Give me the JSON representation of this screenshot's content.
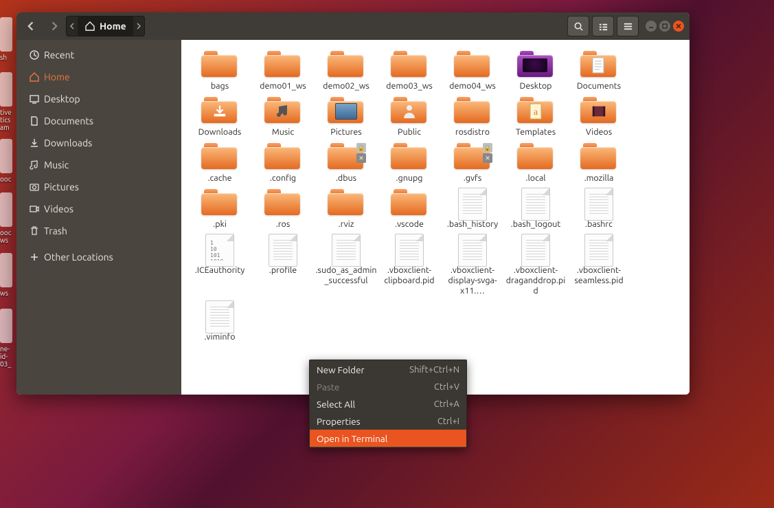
{
  "breadcrumb": {
    "current": "Home"
  },
  "sidebar": {
    "items": [
      {
        "label": "Recent"
      },
      {
        "label": "Home"
      },
      {
        "label": "Desktop"
      },
      {
        "label": "Documents"
      },
      {
        "label": "Downloads"
      },
      {
        "label": "Music"
      },
      {
        "label": "Pictures"
      },
      {
        "label": "Videos"
      },
      {
        "label": "Trash"
      },
      {
        "label": "Other Locations"
      }
    ]
  },
  "files": [
    {
      "label": "bags",
      "type": "folder"
    },
    {
      "label": "demo01_ws",
      "type": "folder"
    },
    {
      "label": "demo02_ws",
      "type": "folder"
    },
    {
      "label": "demo03_ws",
      "type": "folder"
    },
    {
      "label": "demo04_ws",
      "type": "folder"
    },
    {
      "label": "Desktop",
      "type": "folder",
      "variant": "purple-portal"
    },
    {
      "label": "Documents",
      "type": "folder",
      "emblem": "document"
    },
    {
      "label": "Downloads",
      "type": "folder",
      "emblem": "download"
    },
    {
      "label": "Music",
      "type": "folder",
      "emblem": "music"
    },
    {
      "label": "Pictures",
      "type": "folder",
      "emblem": "pictures"
    },
    {
      "label": "Public",
      "type": "folder",
      "emblem": "public"
    },
    {
      "label": "rosdistro",
      "type": "folder"
    },
    {
      "label": "Templates",
      "type": "folder",
      "emblem": "templates"
    },
    {
      "label": "Videos",
      "type": "folder",
      "emblem": "videos"
    },
    {
      "label": ".cache",
      "type": "folder"
    },
    {
      "label": ".config",
      "type": "folder"
    },
    {
      "label": ".dbus",
      "type": "folder",
      "locked": true
    },
    {
      "label": ".gnupg",
      "type": "folder"
    },
    {
      "label": ".gvfs",
      "type": "folder",
      "locked": true
    },
    {
      "label": ".local",
      "type": "folder"
    },
    {
      "label": ".mozilla",
      "type": "folder"
    },
    {
      "label": ".pki",
      "type": "folder"
    },
    {
      "label": ".ros",
      "type": "folder"
    },
    {
      "label": ".rviz",
      "type": "folder"
    },
    {
      "label": ".vscode",
      "type": "folder"
    },
    {
      "label": ".bash_history",
      "type": "file"
    },
    {
      "label": ".bash_logout",
      "type": "file"
    },
    {
      "label": ".bashrc",
      "type": "file"
    },
    {
      "label": ".ICEauthority",
      "type": "file",
      "variant": "binary"
    },
    {
      "label": ".profile",
      "type": "file"
    },
    {
      "label": ".sudo_as_admin_successful",
      "type": "file"
    },
    {
      "label": ".vboxclient-clipboard.pid",
      "type": "file"
    },
    {
      "label": ".vboxclient-display-svga-x11.…",
      "type": "file"
    },
    {
      "label": ".vboxclient-draganddrop.pid",
      "type": "file"
    },
    {
      "label": ".vboxclient-seamless.pid",
      "type": "file"
    },
    {
      "label": ".viminfo",
      "type": "file"
    }
  ],
  "context_menu": {
    "items": [
      {
        "label": "New Folder",
        "shortcut": "Shift+Ctrl+N",
        "enabled": true
      },
      {
        "label": "Paste",
        "shortcut": "Ctrl+V",
        "enabled": false
      },
      {
        "label": "Select All",
        "shortcut": "Ctrl+A",
        "enabled": true
      },
      {
        "label": "Properties",
        "shortcut": "Ctrl+I",
        "enabled": true
      },
      {
        "label": "Open in Terminal",
        "shortcut": "",
        "enabled": true,
        "hover": true
      }
    ]
  },
  "desktop_fragments": [
    "sh",
    "tive\ntics\nam",
    "ooc",
    "ooc\nws",
    "ws",
    "ne-\nid-\n03_"
  ]
}
